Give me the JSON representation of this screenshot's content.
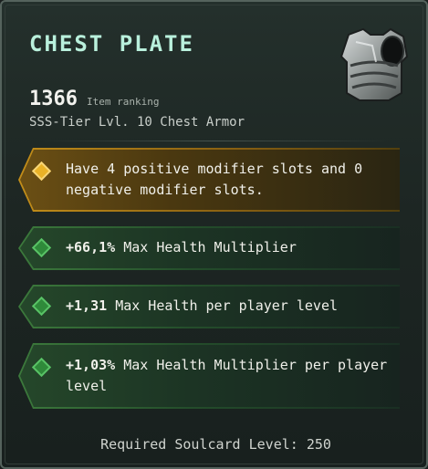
{
  "item": {
    "name": "CHEST PLATE",
    "icon": "chest-armor-icon",
    "ranking_value": "1366",
    "ranking_label": "Item ranking",
    "subtitle": "SSS-Tier Lvl. 10 Chest Armor"
  },
  "modifiers": [
    {
      "type": "gold",
      "icon": "gold-diamond-icon",
      "text": "Have 4 positive modifier slots and 0 negative modifier slots."
    },
    {
      "type": "green",
      "icon": "green-diamond-icon",
      "value": "+66,1%",
      "text": "Max Health Multiplier"
    },
    {
      "type": "green",
      "icon": "green-diamond-icon",
      "value": "+1,31",
      "text": "Max Health per player level"
    },
    {
      "type": "green",
      "icon": "green-diamond-icon",
      "value": "+1,03%",
      "text": "Max Health Multiplier per player level"
    }
  ],
  "footer": {
    "requirement": "Required Soulcard Level: 250"
  },
  "colors": {
    "title": "#b9f0dc",
    "gold_accent": "#e9b227",
    "green_accent": "#2f8a3a"
  }
}
